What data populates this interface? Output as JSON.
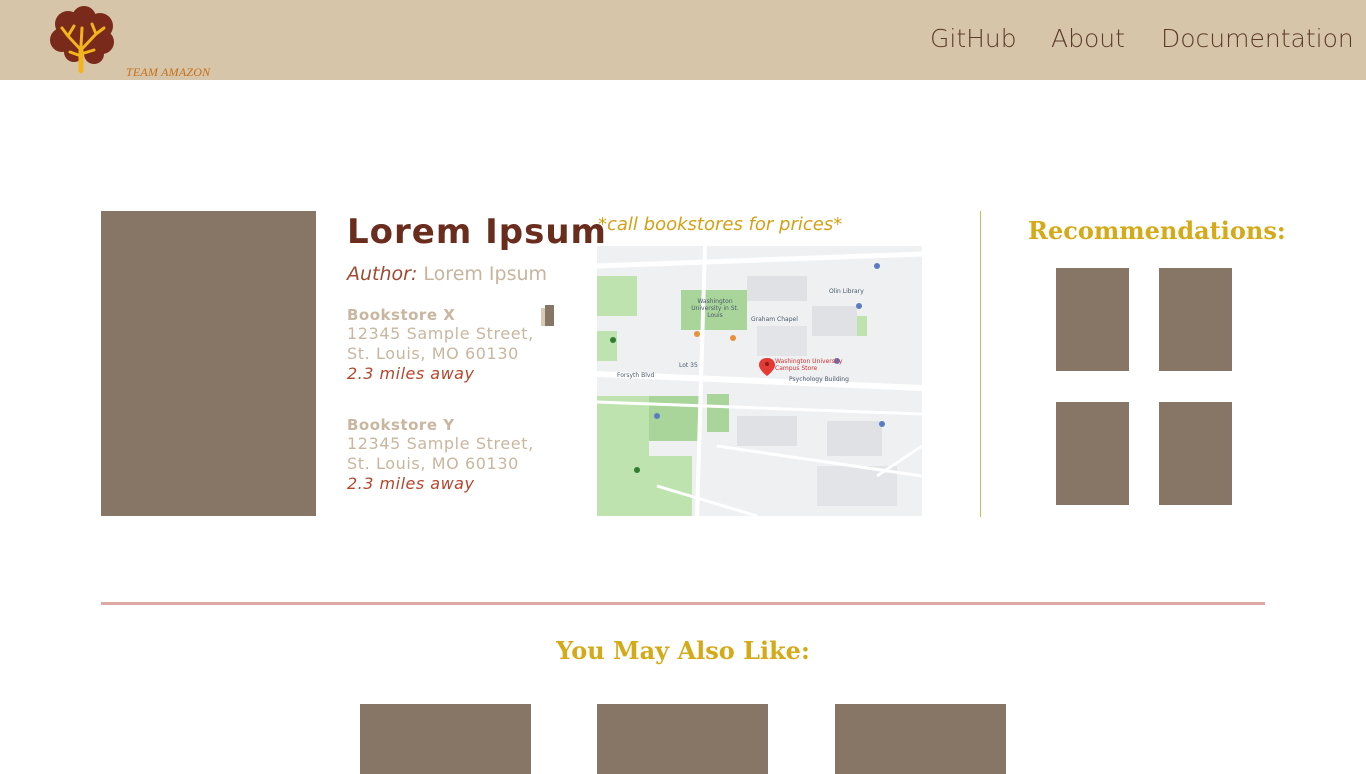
{
  "header": {
    "logo_text": "TEAM AMAZON",
    "nav": [
      "GitHub",
      "About",
      "Documentation"
    ]
  },
  "book": {
    "title": "Lorem Ipsum",
    "author_label": "Author:",
    "author_name": "Lorem Ipsum",
    "stores": [
      {
        "name": "Bookstore X",
        "address_line1": "12345 Sample Street,",
        "address_line2": "St. Louis, MO 60130",
        "distance": "2.3 miles away"
      },
      {
        "name": "Bookstore Y",
        "address_line1": "12345 Sample Street,",
        "address_line2": "St. Louis, MO 60130",
        "distance": "2.3 miles away"
      }
    ]
  },
  "map": {
    "note": "*call bookstores for prices*",
    "pin_label_line1": "Washington University",
    "pin_label_line2": "Campus Store",
    "labels": [
      "Washington University in St. Louis",
      "Forsyth Blvd",
      "Olin Library",
      "Graham Chapel",
      "Psychology Building",
      "Lot 35"
    ]
  },
  "recommendations": {
    "title": "Recommendations:"
  },
  "also_like": {
    "title": "You May Also Like:"
  },
  "colors": {
    "header_bg": "#d7c5a9",
    "placeholder": "#877565",
    "accent_gold": "#d4aa18",
    "title_brown": "#6a2c1d",
    "divider_pink": "#dca9a3"
  }
}
